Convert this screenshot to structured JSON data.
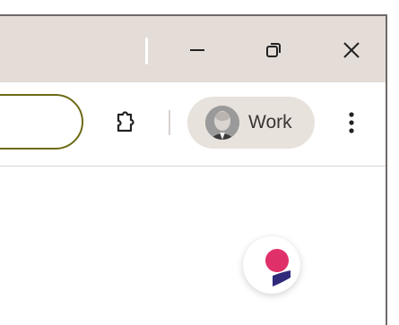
{
  "profile": {
    "name": "Work"
  },
  "icons": {
    "minimize": "minimize-icon",
    "restore": "restore-icon",
    "close": "close-icon",
    "extensions": "puzzle-icon",
    "menu": "more-vert-icon",
    "fab": "assistant-icon"
  },
  "colors": {
    "titlebar": "#e3dcd7",
    "omnibox_border": "#6d6a16",
    "profile_chip": "#e8e2dc",
    "fab_dot": "#e0306a",
    "fab_base": "#2f2a7a"
  }
}
